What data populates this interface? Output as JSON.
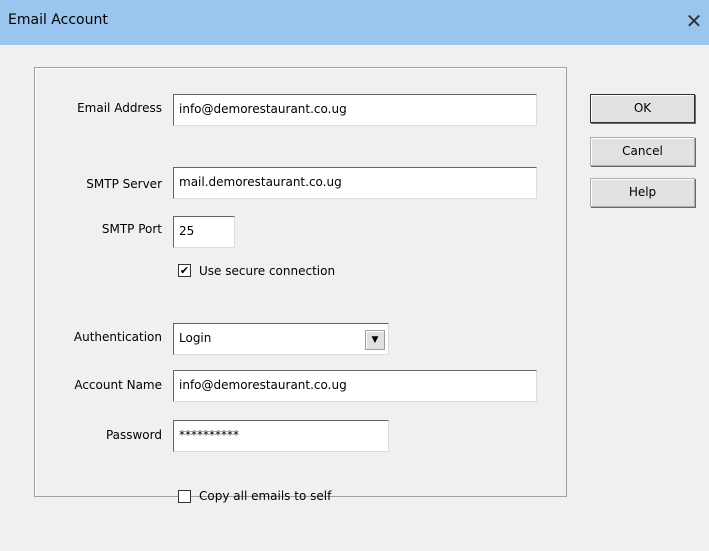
{
  "window": {
    "title": "Email Account",
    "close_glyph": "✕"
  },
  "form": {
    "email_address_label": "Email Address",
    "email_address_value": "info@demorestaurant.co.ug",
    "smtp_server_label": "SMTP Server",
    "smtp_server_value": "mail.demorestaurant.co.ug",
    "smtp_port_label": "SMTP Port",
    "smtp_port_value": "25",
    "secure_label": "Use secure connection",
    "secure_checked": true,
    "authentication_label": "Authentication",
    "authentication_value": "Login",
    "account_name_label": "Account Name",
    "account_name_value": "info@demorestaurant.co.ug",
    "password_label": "Password",
    "password_value": "**********",
    "copy_label": "Copy all emails to self",
    "copy_checked": false
  },
  "buttons": {
    "ok": "OK",
    "cancel": "Cancel",
    "help": "Help"
  },
  "icons": {
    "checkmark": "check-icon",
    "dropdown": "chevron-down-icon",
    "close": "close-icon"
  }
}
